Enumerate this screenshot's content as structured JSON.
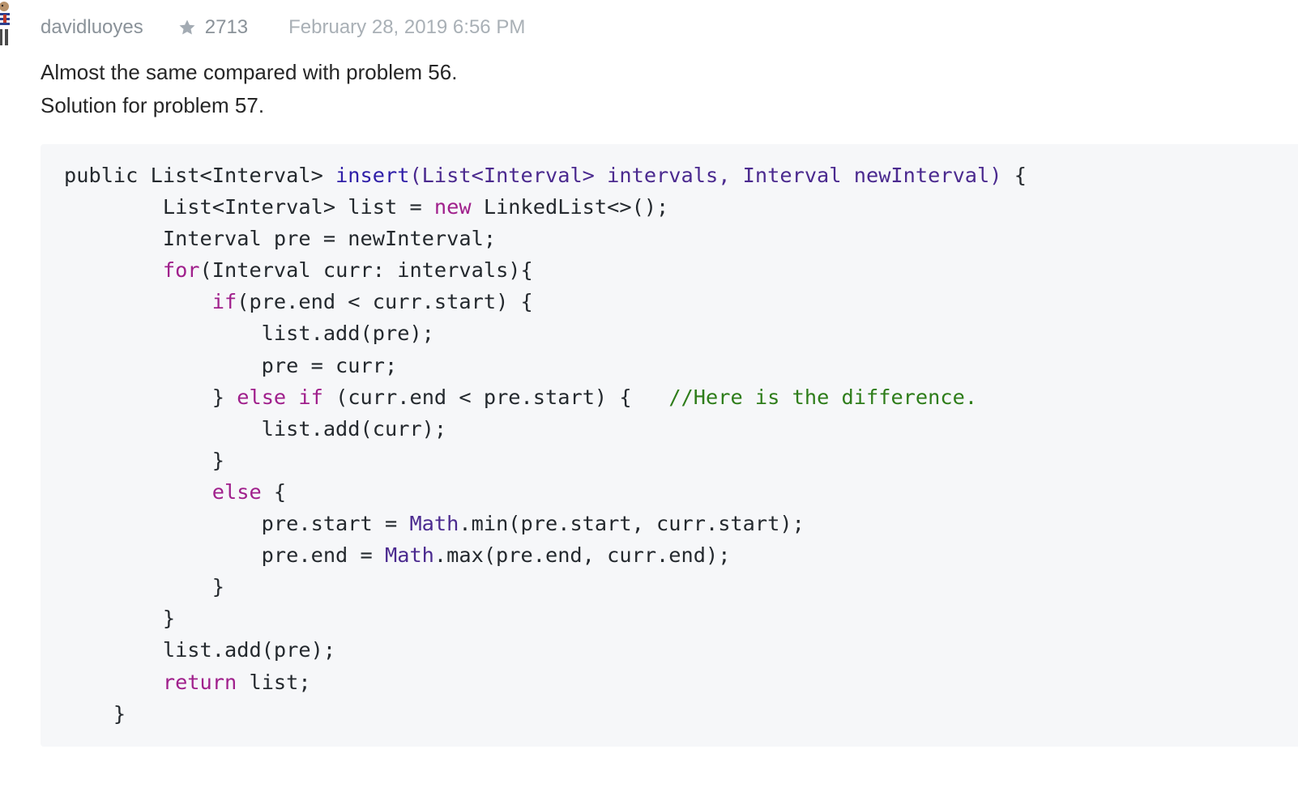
{
  "post": {
    "author": "davidluoyes",
    "votes": "2713",
    "date": "February 28, 2019 6:56 PM",
    "paragraphs": [
      "Almost the same compared with problem 56.",
      "Solution for problem 57."
    ]
  },
  "icons": {
    "avatar": "avatar-image",
    "votes": "star-icon"
  },
  "colors": {
    "keyword": "#a0208c",
    "function": "#2f1fa8",
    "type": "#4b2a8f",
    "comment": "#2e7d1a",
    "code_background": "#f6f7f9",
    "meta_text": "#8a9299"
  },
  "code": {
    "language": "java",
    "lines": [
      [
        {
          "t": "plain",
          "v": "public List<Interval> "
        },
        {
          "t": "fn",
          "v": "insert"
        },
        {
          "t": "param",
          "v": "(List<Interval> intervals, Interval newInterval)"
        },
        {
          "t": "plain",
          "v": " {"
        }
      ],
      [
        {
          "t": "plain",
          "v": "        List<Interval> list = "
        },
        {
          "t": "kw",
          "v": "new"
        },
        {
          "t": "plain",
          "v": " LinkedList<>();"
        }
      ],
      [
        {
          "t": "plain",
          "v": "        Interval pre = newInterval;"
        }
      ],
      [
        {
          "t": "plain",
          "v": "        "
        },
        {
          "t": "kw",
          "v": "for"
        },
        {
          "t": "plain",
          "v": "(Interval curr: intervals){"
        }
      ],
      [
        {
          "t": "plain",
          "v": "            "
        },
        {
          "t": "kw",
          "v": "if"
        },
        {
          "t": "plain",
          "v": "(pre.end < curr.start) {"
        }
      ],
      [
        {
          "t": "plain",
          "v": "                list.add(pre);"
        }
      ],
      [
        {
          "t": "plain",
          "v": "                pre = curr;"
        }
      ],
      [
        {
          "t": "plain",
          "v": "            } "
        },
        {
          "t": "kw",
          "v": "else"
        },
        {
          "t": "plain",
          "v": " "
        },
        {
          "t": "kw",
          "v": "if"
        },
        {
          "t": "plain",
          "v": " (curr.end < pre.start) {   "
        },
        {
          "t": "comment",
          "v": "//Here is the difference."
        }
      ],
      [
        {
          "t": "plain",
          "v": "                list.add(curr);"
        }
      ],
      [
        {
          "t": "plain",
          "v": "            }"
        }
      ],
      [
        {
          "t": "plain",
          "v": "            "
        },
        {
          "t": "kw",
          "v": "else"
        },
        {
          "t": "plain",
          "v": " {"
        }
      ],
      [
        {
          "t": "plain",
          "v": "                pre.start = "
        },
        {
          "t": "type",
          "v": "Math"
        },
        {
          "t": "plain",
          "v": ".min(pre.start, curr.start);"
        }
      ],
      [
        {
          "t": "plain",
          "v": "                pre.end = "
        },
        {
          "t": "type",
          "v": "Math"
        },
        {
          "t": "plain",
          "v": ".max(pre.end, curr.end);"
        }
      ],
      [
        {
          "t": "plain",
          "v": "            }"
        }
      ],
      [
        {
          "t": "plain",
          "v": "        }"
        }
      ],
      [
        {
          "t": "plain",
          "v": "        list.add(pre);"
        }
      ],
      [
        {
          "t": "plain",
          "v": "        "
        },
        {
          "t": "kw",
          "v": "return"
        },
        {
          "t": "plain",
          "v": " list;"
        }
      ],
      [
        {
          "t": "plain",
          "v": "    }"
        }
      ]
    ]
  }
}
